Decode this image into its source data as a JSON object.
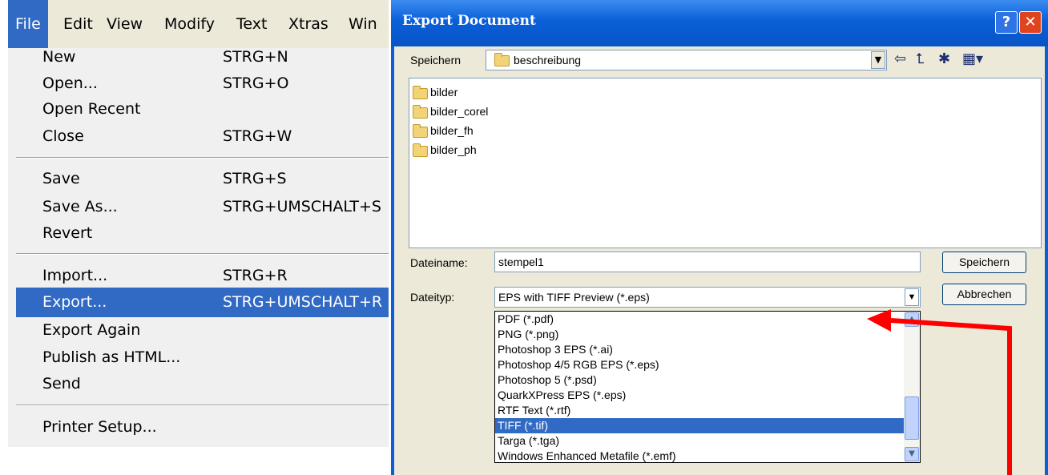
{
  "menubar": {
    "items": [
      {
        "label": "File"
      },
      {
        "label": "Edit"
      },
      {
        "label": "View"
      },
      {
        "label": "Modify"
      },
      {
        "label": "Text"
      },
      {
        "label": "Xtras"
      },
      {
        "label": "Win"
      }
    ]
  },
  "file_menu": {
    "groups": [
      [
        {
          "label": "New",
          "shortcut": "STRG+N"
        },
        {
          "label": "Open...",
          "shortcut": "STRG+O"
        },
        {
          "label": "Open Recent",
          "shortcut": ""
        },
        {
          "label": "Close",
          "shortcut": "STRG+W"
        }
      ],
      [
        {
          "label": "Save",
          "shortcut": "STRG+S"
        },
        {
          "label": "Save As...",
          "shortcut": "STRG+UMSCHALT+S"
        },
        {
          "label": "Revert",
          "shortcut": ""
        }
      ],
      [
        {
          "label": "Import...",
          "shortcut": "STRG+R"
        },
        {
          "label": "Export...",
          "shortcut": "STRG+UMSCHALT+R",
          "highlighted": true
        },
        {
          "label": "Export Again",
          "shortcut": ""
        },
        {
          "label": "Publish as HTML...",
          "shortcut": ""
        },
        {
          "label": "Send",
          "shortcut": ""
        }
      ],
      [
        {
          "label": "Printer Setup...",
          "shortcut": ""
        }
      ]
    ]
  },
  "dialog": {
    "title": "Export Document",
    "help_glyph": "?",
    "close_glyph": "✕",
    "save_in_label": "Speichern",
    "save_in_value": "beschreibung",
    "files": [
      "bilder",
      "bilder_corel",
      "bilder_fh",
      "bilder_ph"
    ],
    "filename_label": "Dateiname:",
    "filename_value": "stempel1",
    "filetype_label": "Dateityp:",
    "filetype_value": "EPS with TIFF Preview (*.eps)",
    "save_button": "Speichern",
    "cancel_button": "Abbrechen",
    "filetype_options": [
      {
        "label": "PDF (*.pdf)"
      },
      {
        "label": "PNG (*.png)"
      },
      {
        "label": "Photoshop 3 EPS (*.ai)"
      },
      {
        "label": "Photoshop 4/5 RGB EPS (*.eps)"
      },
      {
        "label": "Photoshop 5 (*.psd)"
      },
      {
        "label": "QuarkXPress EPS (*.eps)"
      },
      {
        "label": "RTF Text (*.rtf)"
      },
      {
        "label": "TIFF (*.tif)",
        "selected": true
      },
      {
        "label": "Targa (*.tga)"
      },
      {
        "label": "Windows Enhanced Metafile (*.emf)"
      }
    ]
  },
  "colors": {
    "selection": "#316ac5",
    "title_bar": "#0a5fd8",
    "annotation_arrow": "#ff0000"
  },
  "icons": [
    "folder-icon",
    "back-arrow-icon",
    "up-folder-icon",
    "new-folder-icon",
    "view-menu-icon",
    "help-icon",
    "close-icon",
    "chevron-down-icon"
  ]
}
